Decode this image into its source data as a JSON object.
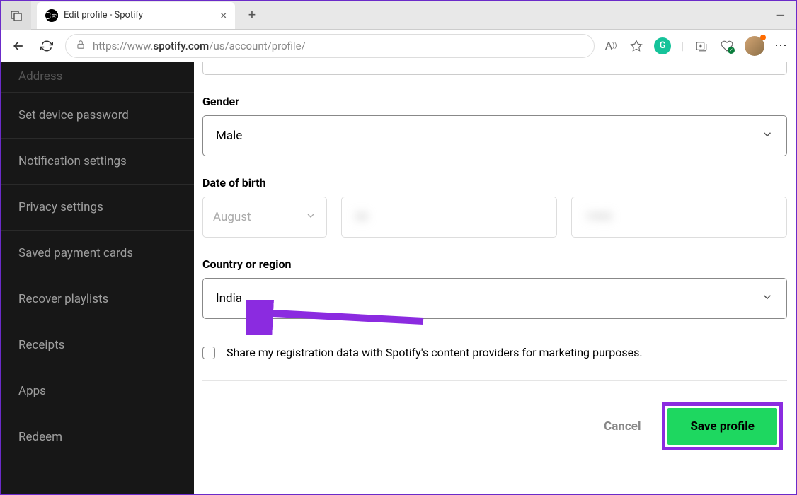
{
  "browser": {
    "tab_title": "Edit profile - Spotify",
    "url": "https://www.spotify.com/us/account/profile/",
    "url_protocol": "https://",
    "url_domain_prefix": "www.",
    "url_domain": "spotify.com",
    "url_path": "/us/account/profile/"
  },
  "sidebar": {
    "items": [
      "Address",
      "Set device password",
      "Notification settings",
      "Privacy settings",
      "Saved payment cards",
      "Recover playlists",
      "Receipts",
      "Apps",
      "Redeem"
    ]
  },
  "form": {
    "gender": {
      "label": "Gender",
      "value": "Male"
    },
    "dob": {
      "label": "Date of birth",
      "month": "August",
      "day": "30",
      "year": "1995"
    },
    "country": {
      "label": "Country or region",
      "value": "India"
    },
    "share_checkbox": {
      "label": "Share my registration data with Spotify's content providers for marketing purposes."
    },
    "buttons": {
      "cancel": "Cancel",
      "save": "Save profile"
    }
  }
}
